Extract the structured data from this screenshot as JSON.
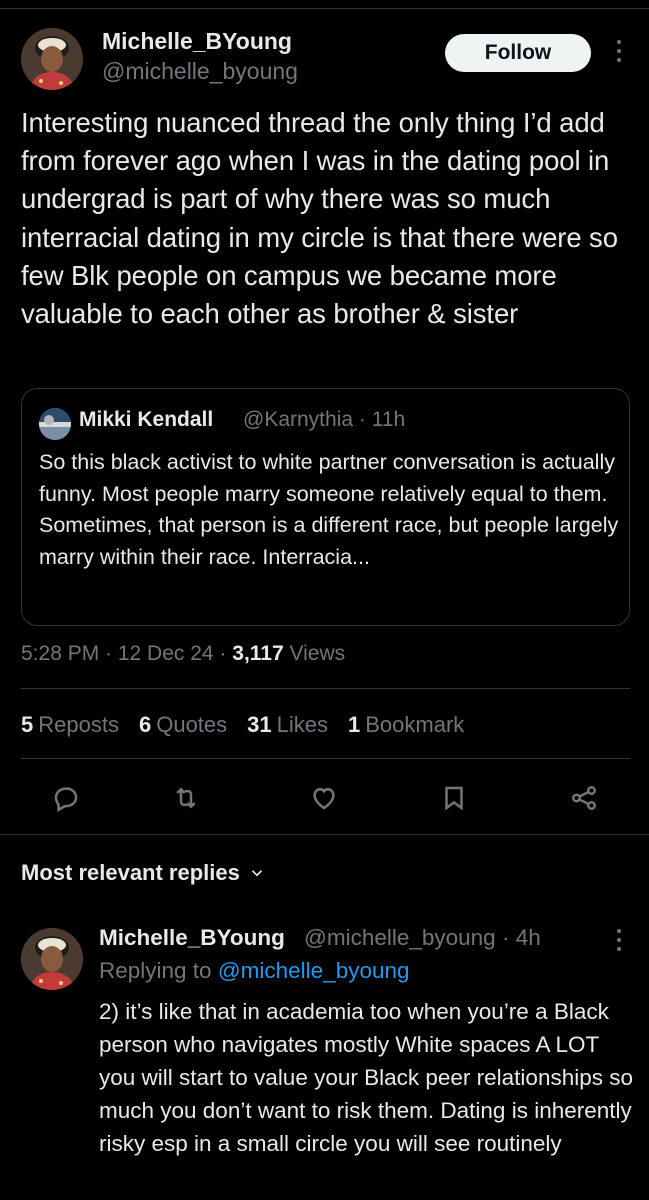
{
  "tweet": {
    "author_name": "Michelle_BYoung",
    "author_handle": "@michelle_byoung",
    "follow_label": "Follow",
    "text": "Interesting nuanced thread the only thing I’d add from forever ago when I was in the dating pool in undergrad is part of why there was so much interracial dating in my circle is that there were so few Blk people on campus we became more valuable to each other as brother & sister",
    "quote": {
      "author_name": "Mikki Kendall",
      "author_handle": "@Karnythia · 11h",
      "text": "So this black activist to white partner conversation is actually funny. Most people marry someone relatively equal to them. Sometimes, that person is a different race, but people largely marry within their race. Interracia..."
    },
    "time": "5:28 PM · 12 Dec 24 · ",
    "views_count": "3,117",
    "views_label": " Views",
    "stats": {
      "reposts_count": "5",
      "reposts_label": "Reposts",
      "quotes_count": "6",
      "quotes_label": "Quotes",
      "likes_count": "31",
      "likes_label": "Likes",
      "bookmarks_count": "1",
      "bookmarks_label": "Bookmark"
    }
  },
  "actions": [
    "reply-icon",
    "repost-icon",
    "like-icon",
    "bookmark-icon",
    "share-icon"
  ],
  "replies_sort_label": "Most relevant replies",
  "reply": {
    "author_name": "Michelle_BYoung",
    "author_handle": "@michelle_byoung · 4h",
    "replying_prefix": "Replying to ",
    "replying_to": "@michelle_byoung",
    "text": "2) it’s like that in academia too when you’re a Black person who navigates mostly White spaces A LOT you will start to value your Black peer relationships so much you don’t want to risk them. Dating is inherently risky esp in a small circle you will see routinely"
  },
  "colors": {
    "background": "#000000",
    "text": "#e7e9ea",
    "muted": "#71767b",
    "link": "#1d9bf0",
    "border": "#2f3336"
  }
}
